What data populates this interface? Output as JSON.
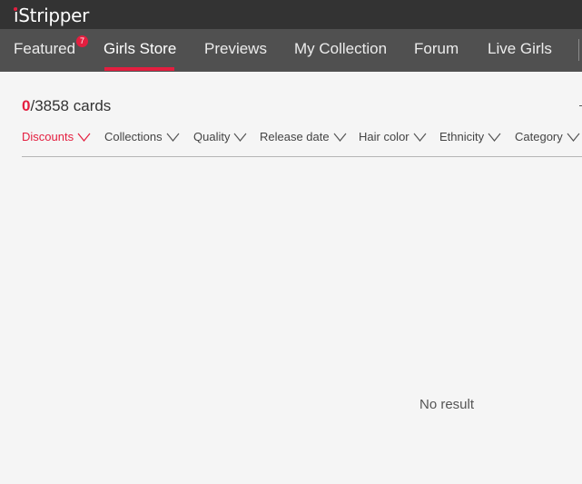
{
  "app": {
    "logo_text": "iStripper"
  },
  "nav": {
    "items": [
      {
        "label": "Featured"
      },
      {
        "label": "Girls Store"
      },
      {
        "label": "Previews"
      },
      {
        "label": "My Collection"
      },
      {
        "label": "Forum"
      },
      {
        "label": "Live Girls"
      }
    ],
    "featured_badge": "7",
    "active_item": "Girls Store"
  },
  "store": {
    "owned_count": "0",
    "total_text": "/3858 cards"
  },
  "filters": [
    {
      "label": "Discounts"
    },
    {
      "label": "Collections"
    },
    {
      "label": "Quality"
    },
    {
      "label": "Release date"
    },
    {
      "label": "Hair color"
    },
    {
      "label": "Ethnicity"
    },
    {
      "label": "Category"
    }
  ],
  "results": {
    "empty_text": "No result"
  },
  "colors": {
    "accent": "#e41e3f",
    "titlebar": "#333333",
    "navbar": "#505050",
    "background": "#f5f5f5"
  }
}
